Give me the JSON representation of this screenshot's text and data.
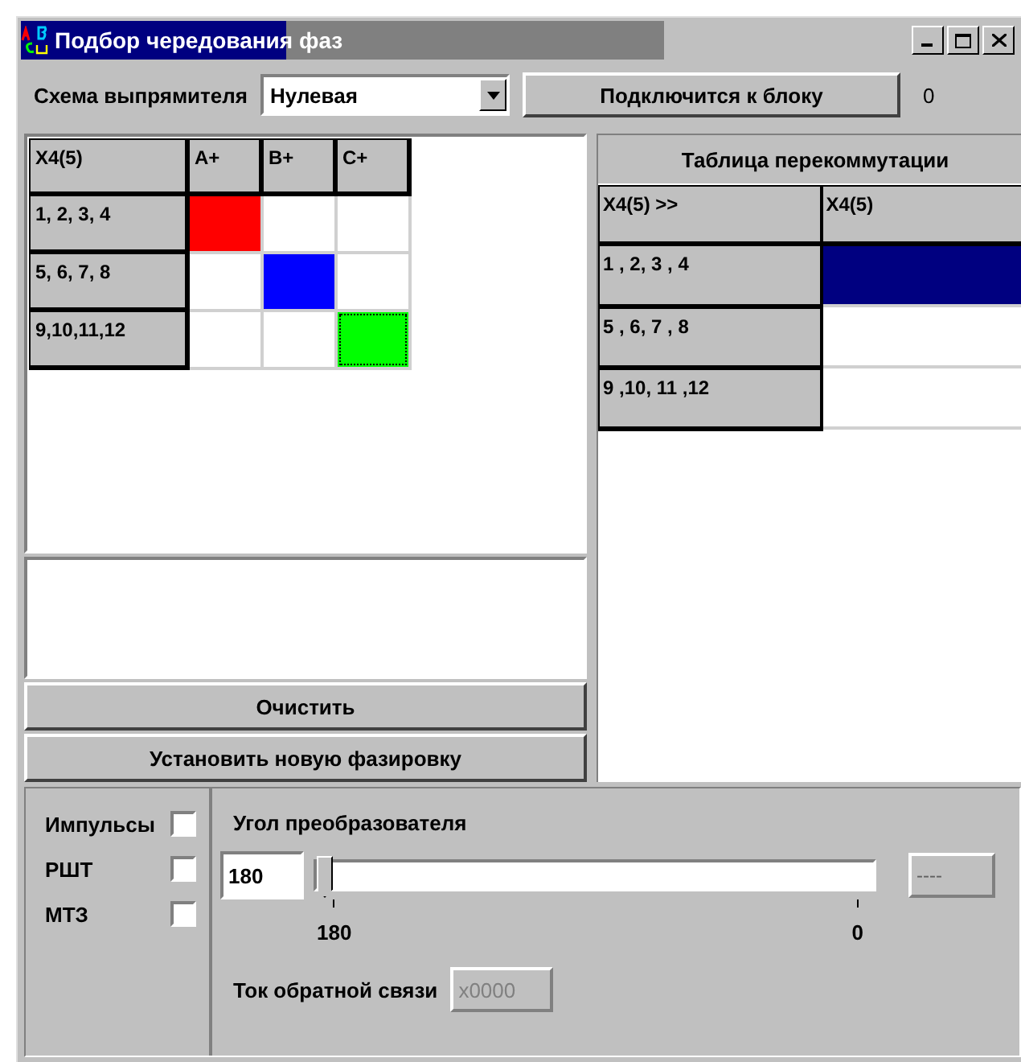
{
  "window": {
    "title": "Подбор чередования фаз"
  },
  "toolbar": {
    "scheme_label": "Схема выпрямителя",
    "scheme_value": "Нулевая",
    "connect_button": "Подключится к блоку",
    "counter": "0"
  },
  "phase_grid": {
    "columns": [
      "X4(5)",
      "A+",
      "B+",
      "C+"
    ],
    "rows": [
      {
        "label": "1, 2, 3, 4",
        "cells": [
          {
            "color": "#ff0000",
            "focused": false
          },
          {
            "color": "#ffffff",
            "focused": false
          },
          {
            "color": "#ffffff",
            "focused": false
          }
        ]
      },
      {
        "label": "5, 6, 7, 8",
        "cells": [
          {
            "color": "#ffffff",
            "focused": false
          },
          {
            "color": "#0000ff",
            "focused": false
          },
          {
            "color": "#ffffff",
            "focused": false
          }
        ]
      },
      {
        "label": "9,10,11,12",
        "cells": [
          {
            "color": "#ffffff",
            "focused": false
          },
          {
            "color": "#ffffff",
            "focused": false
          },
          {
            "color": "#00ff00",
            "focused": true
          }
        ]
      }
    ]
  },
  "buttons": [
    "Очистить",
    "Установить новую фазировку"
  ],
  "switch_table": {
    "title": "Таблица перекоммутации",
    "columns": [
      "X4(5) >>",
      "X4(5)"
    ],
    "rows": [
      {
        "label": "1 , 2,  3 , 4",
        "selected": true
      },
      {
        "label": "5 , 6,  7 , 8",
        "selected": false
      },
      {
        "label": "9 ,10, 11 ,12",
        "selected": false
      }
    ]
  },
  "options": [
    {
      "label": "Импульсы",
      "checked": false
    },
    {
      "label": "РШТ",
      "checked": false
    },
    {
      "label": "МТЗ",
      "checked": false
    }
  ],
  "angle": {
    "label": "Угол преобразователя",
    "value": "180",
    "level": 0,
    "readout": "----",
    "min_label": "180",
    "max_label": "0"
  },
  "feedback": {
    "label": "Ток обратной связи",
    "value": "x0000"
  }
}
